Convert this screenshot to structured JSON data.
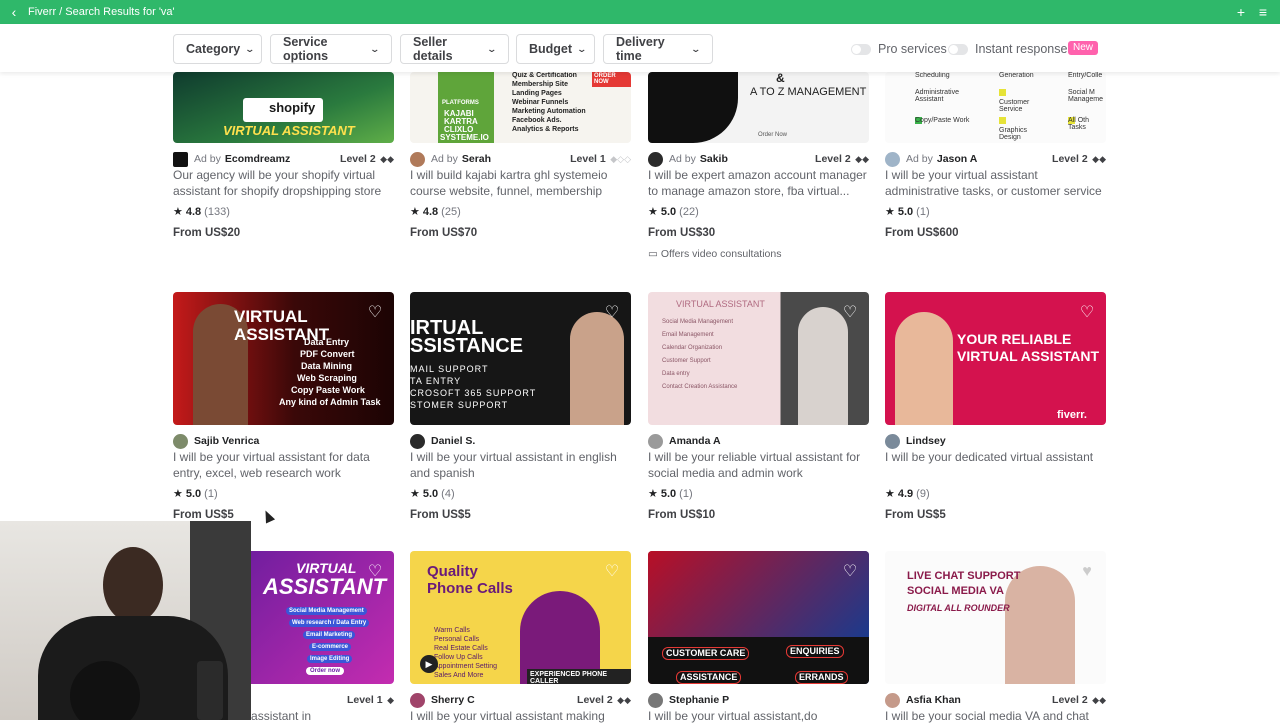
{
  "appbar": {
    "title": "Fiverr / Search Results for 'va'"
  },
  "filters": {
    "category": "Category",
    "service_options": "Service options",
    "seller_details": "Seller details",
    "budget": "Budget",
    "delivery_time": "Delivery time",
    "pro_services": "Pro services",
    "instant_response": "Instant response",
    "new_badge": "New"
  },
  "row1": [
    {
      "ad": "Ad by",
      "seller": "Ecomdreamz",
      "level": "Level 2",
      "desc": "Our agency will be your shopify virtual assistant for shopify dropshipping store",
      "rating": "4.8",
      "count": "(133)",
      "price": "From US$20",
      "thumb_text": [
        "shopify",
        "VIRTUAL ASSISTANT"
      ]
    },
    {
      "ad": "Ad by",
      "seller": "Serah",
      "level": "Level 1",
      "desc": "I will build kajabi kartra ghl systemeio course website, funnel, membership site,...",
      "rating": "4.8",
      "count": "(25)",
      "price": "From US$70",
      "thumb_text": [
        "Quiz & Certification",
        "Membership Site",
        "Landing Pages",
        "Webinar Funnels",
        "Marketing Automation",
        "Facebook Ads.",
        "Analytics & Reports",
        "KAJABI",
        "KARTRA",
        "CLIXLO",
        "SYSTEME.IO",
        "ORDER NOW",
        "PLATFORMS"
      ]
    },
    {
      "ad": "Ad by",
      "seller": "Sakib",
      "level": "Level 2",
      "desc": "I will be expert amazon account manager to manage amazon store, fba virtual...",
      "rating": "5.0",
      "count": "(22)",
      "price": "From US$30",
      "consult": "Offers video consultations",
      "thumb_text": [
        "&",
        "A TO Z MANAGEMENT",
        "Order Now"
      ]
    },
    {
      "ad": "Ad by",
      "seller": "Jason A",
      "level": "Level 2",
      "desc": "I will be your virtual assistant administrative tasks, or customer service",
      "rating": "5.0",
      "count": "(1)",
      "price": "From US$600",
      "thumb_text": [
        "Scheduling",
        "Generation",
        "Entry/Colle",
        "Administrative Assistant",
        "Customer Service",
        "Social M Manageme",
        "Copy/Paste Work",
        "Graphics Design",
        "All Oth Tasks"
      ]
    }
  ],
  "row2": [
    {
      "seller": "Sajib Venrica",
      "desc": "I will be your virtual assistant for data entry, excel, web research work",
      "rating": "5.0",
      "count": "(1)",
      "price": "From US$5",
      "thumb_text": [
        "VIRTUAL ASSISTANT",
        "Data Entry",
        "PDF Convert",
        "Data Mining",
        "Web Scraping",
        "Copy Paste Work",
        "Any kind of Admin Task"
      ]
    },
    {
      "seller": "Daniel S.",
      "desc": "I will be your virtual assistant in english and spanish",
      "rating": "5.0",
      "count": "(4)",
      "price": "From US$5",
      "thumb_text": [
        "IRTUAL",
        "SSISTANCE",
        "MAIL SUPPORT",
        "TA ENTRY",
        "CROSOFT 365 SUPPORT",
        "STOMER SUPPORT"
      ]
    },
    {
      "seller": "Amanda A",
      "desc": "I will be your reliable virtual assistant for social media and admin work",
      "rating": "5.0",
      "count": "(1)",
      "price": "From US$10",
      "thumb_text": [
        "VIRTUAL ASSISTANT",
        "Social Media Management",
        "Email Management",
        "Calendar Organization",
        "Customer Support",
        "Data entry",
        "Contact Creation Assistance"
      ]
    },
    {
      "seller": "Lindsey",
      "desc": "I will be your dedicated virtual assistant",
      "rating": "4.9",
      "count": "(9)",
      "price": "From US$5",
      "thumb_text": [
        "YOUR RELIABLE",
        "VIRTUAL ASSISTANT",
        "fiverr."
      ]
    }
  ],
  "row3": [
    {
      "seller": "",
      "level": "Level 1",
      "desc": "ersonal virtual assistant in",
      "thumb_text": [
        "VIRTUAL",
        "ASSISTANT",
        "Social Media Management",
        "Web research / Data Entry",
        "Email Marketing",
        "E-commerce",
        "Image Editing",
        "Order now"
      ]
    },
    {
      "seller": "Sherry C",
      "level": "Level 2",
      "desc": "I will be your virtual assistant making",
      "thumb_text": [
        "Quality",
        "Phone Calls",
        "Warm Calls",
        "Personal Calls",
        "Real Estate Calls",
        "Follow Up Calls",
        "Appointment Setting",
        "Sales And More",
        "EXPERIENCED PHONE CALLER"
      ]
    },
    {
      "seller": "Stephanie P",
      "level": "",
      "desc": "I will be your virtual assistant,do",
      "thumb_text": [
        "CUSTOMER CARE",
        "ENQUIRIES",
        "ASSISTANCE",
        "ERRANDS"
      ]
    },
    {
      "seller": "Asfia Khan",
      "level": "Level 2",
      "desc": "I will be your social media VA and chat",
      "thumb_text": [
        "LIVE CHAT SUPPORT",
        "SOCIAL MEDIA VA",
        "DIGITAL ALL ROUNDER"
      ]
    }
  ],
  "colors": {
    "brand_green": "#1dbf73",
    "appbar": "#2fb86a",
    "new_badge": "#ff62ad"
  }
}
